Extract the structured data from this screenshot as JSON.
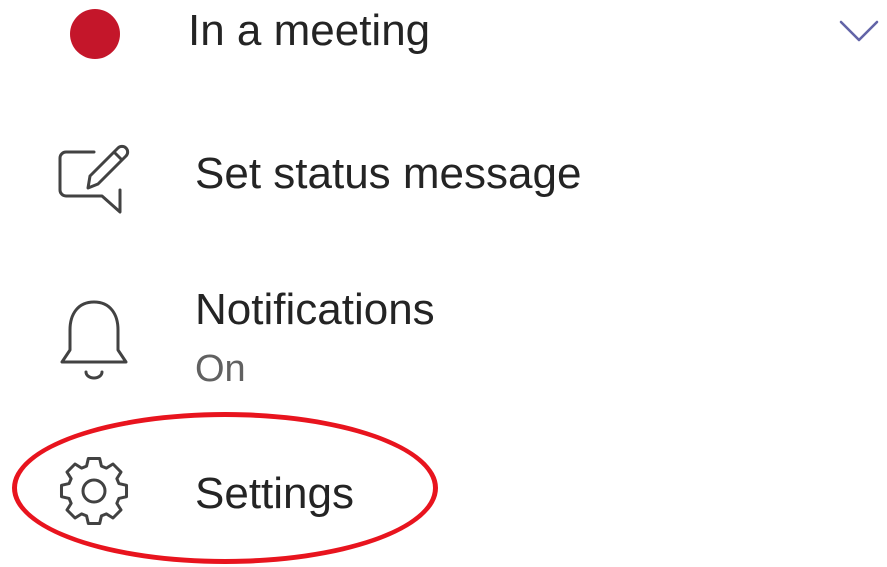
{
  "colors": {
    "presence_busy": "#C4162A",
    "chevron": "#6264A7",
    "icon_stroke": "#424242",
    "annotation": "#E8141E"
  },
  "presence": {
    "label": "In a meeting",
    "status_icon": "red-dot",
    "expand_icon": "chevron-down-icon"
  },
  "menu": {
    "status_message": {
      "label": "Set status message",
      "icon": "edit-message-icon"
    },
    "notifications": {
      "label": "Notifications",
      "value": "On",
      "icon": "bell-icon"
    },
    "settings": {
      "label": "Settings",
      "icon": "gear-icon"
    }
  },
  "annotation": {
    "shape": "ellipse",
    "target": "settings"
  }
}
